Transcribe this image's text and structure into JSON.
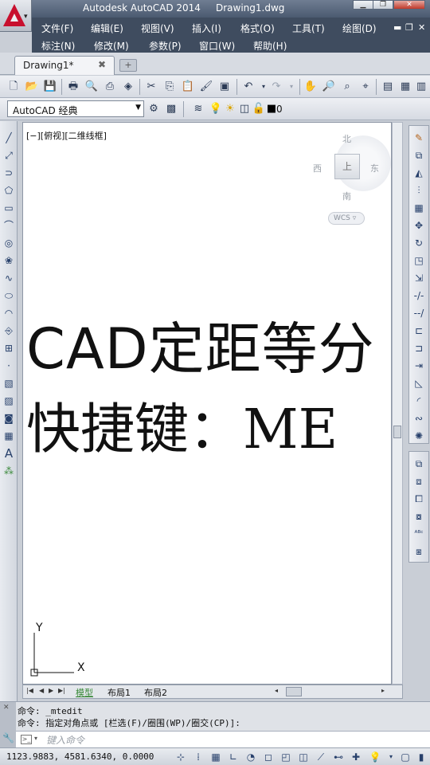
{
  "window": {
    "app_title": "Autodesk AutoCAD 2014",
    "document_title": "Drawing1.dwg"
  },
  "menus": [
    {
      "label": "文件(F)"
    },
    {
      "label": "编辑(E)"
    },
    {
      "label": "视图(V)"
    },
    {
      "label": "插入(I)"
    },
    {
      "label": "格式(O)"
    },
    {
      "label": "工具(T)"
    },
    {
      "label": "绘图(D)"
    },
    {
      "label": "标注(N)"
    },
    {
      "label": "修改(M)"
    },
    {
      "label": "参数(P)"
    },
    {
      "label": "窗口(W)"
    },
    {
      "label": "帮助(H)"
    }
  ],
  "tabs": {
    "document_tab": "Drawing1*"
  },
  "toolbar": {
    "workspace_value": "AutoCAD 经典",
    "layer_value": "0"
  },
  "canvas": {
    "viewport_label": "[−][俯视][二维线框]",
    "title_line1": "CAD定距等分",
    "title_line2": "快捷键：ME"
  },
  "viewcube": {
    "north": "北",
    "south": "南",
    "east": "东",
    "west": "西",
    "wcs_label": "WCS"
  },
  "ucs": {
    "y_label": "Y",
    "x_label": "X"
  },
  "layout_tabs": {
    "model": "模型",
    "layout1": "布局1",
    "layout2": "布局2"
  },
  "command": {
    "history_line1": "命令: _mtedit",
    "history_line2": "命令: 指定对角点或 [栏选(F)/圈围(WP)/圈交(CP)]:",
    "input_placeholder": "键入命令"
  },
  "status": {
    "coordinates": "1123.9883, 4581.6340, 0.0000"
  },
  "colors": {
    "menubar_bg": "#3f4c5f",
    "logo_red": "#c8102e",
    "model_tab_green": "#3a8a3a"
  }
}
